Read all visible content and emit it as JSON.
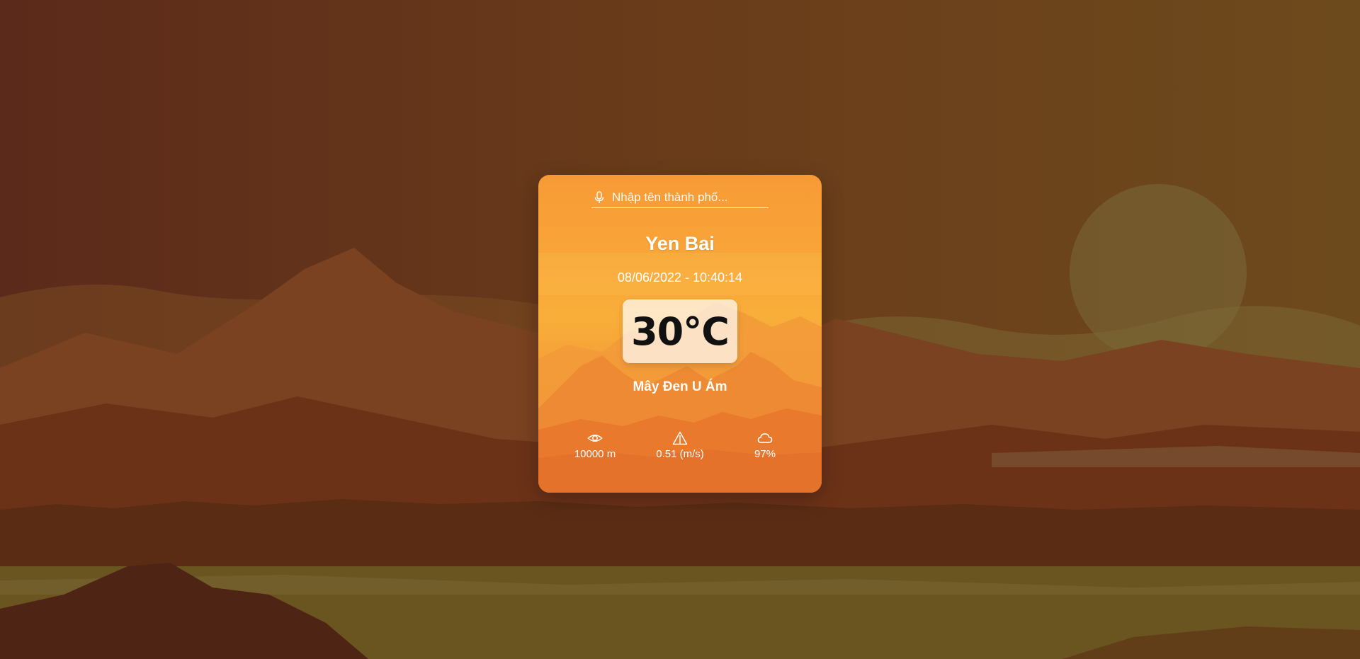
{
  "search": {
    "placeholder": "Nhập tên thành phố..."
  },
  "weather": {
    "city": "Yen Bai",
    "datetime": "08/06/2022 - 10:40:14",
    "temperature": "30°C",
    "description": "Mây Đen U Ám"
  },
  "stats": {
    "visibility": "10000 m",
    "wind": "0.51 (m/s)",
    "clouds": "97%"
  },
  "icons": {
    "search": "microphone-icon",
    "visibility": "eye-icon",
    "wind": "wind-direction-icon",
    "clouds": "cloud-icon"
  },
  "colors": {
    "card_top": "#f79a36",
    "card_bottom": "#e8782a",
    "background": "#6b3a1c"
  }
}
